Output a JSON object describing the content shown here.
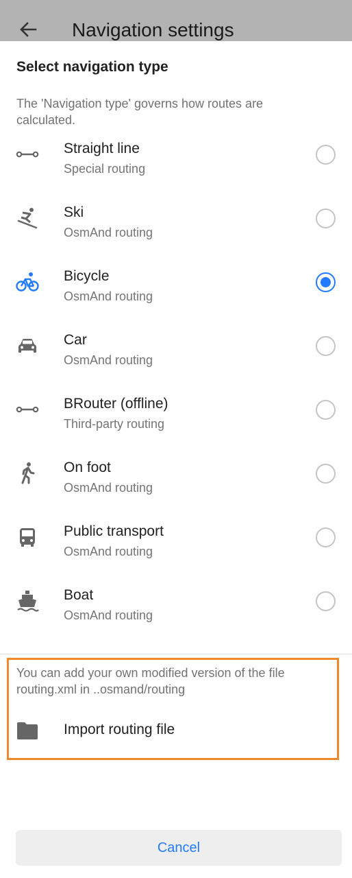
{
  "app_bar": {
    "title": "Navigation settings",
    "back_icon": "arrow-left-icon"
  },
  "sheet": {
    "title": "Select navigation type",
    "description": "The 'Navigation type' governs how routes are calculated.",
    "options": [
      {
        "label": "Straight line",
        "sublabel": "Special routing",
        "icon": "straight-line-icon",
        "selected": false
      },
      {
        "label": "Ski",
        "sublabel": "OsmAnd routing",
        "icon": "skier-icon",
        "selected": false
      },
      {
        "label": "Bicycle",
        "sublabel": "OsmAnd routing",
        "icon": "bicycle-icon",
        "selected": true
      },
      {
        "label": "Car",
        "sublabel": "OsmAnd routing",
        "icon": "car-icon",
        "selected": false
      },
      {
        "label": "BRouter (offline)",
        "sublabel": "Third-party routing",
        "icon": "straight-line-icon",
        "selected": false
      },
      {
        "label": "On foot",
        "sublabel": "OsmAnd routing",
        "icon": "pedestrian-icon",
        "selected": false
      },
      {
        "label": "Public transport",
        "sublabel": "OsmAnd routing",
        "icon": "bus-icon",
        "selected": false
      },
      {
        "label": "Boat",
        "sublabel": "OsmAnd routing",
        "icon": "boat-icon",
        "selected": false
      }
    ],
    "import": {
      "description": "You can add your own modified version of the file routing.xml in ..osmand/routing",
      "label": "Import routing file",
      "icon": "folder-icon"
    },
    "cancel_label": "Cancel"
  },
  "colors": {
    "accent": "#237bff",
    "highlight_border": "#f0882c",
    "icon_gray": "#666666",
    "scrim": "#b3b3b3"
  }
}
